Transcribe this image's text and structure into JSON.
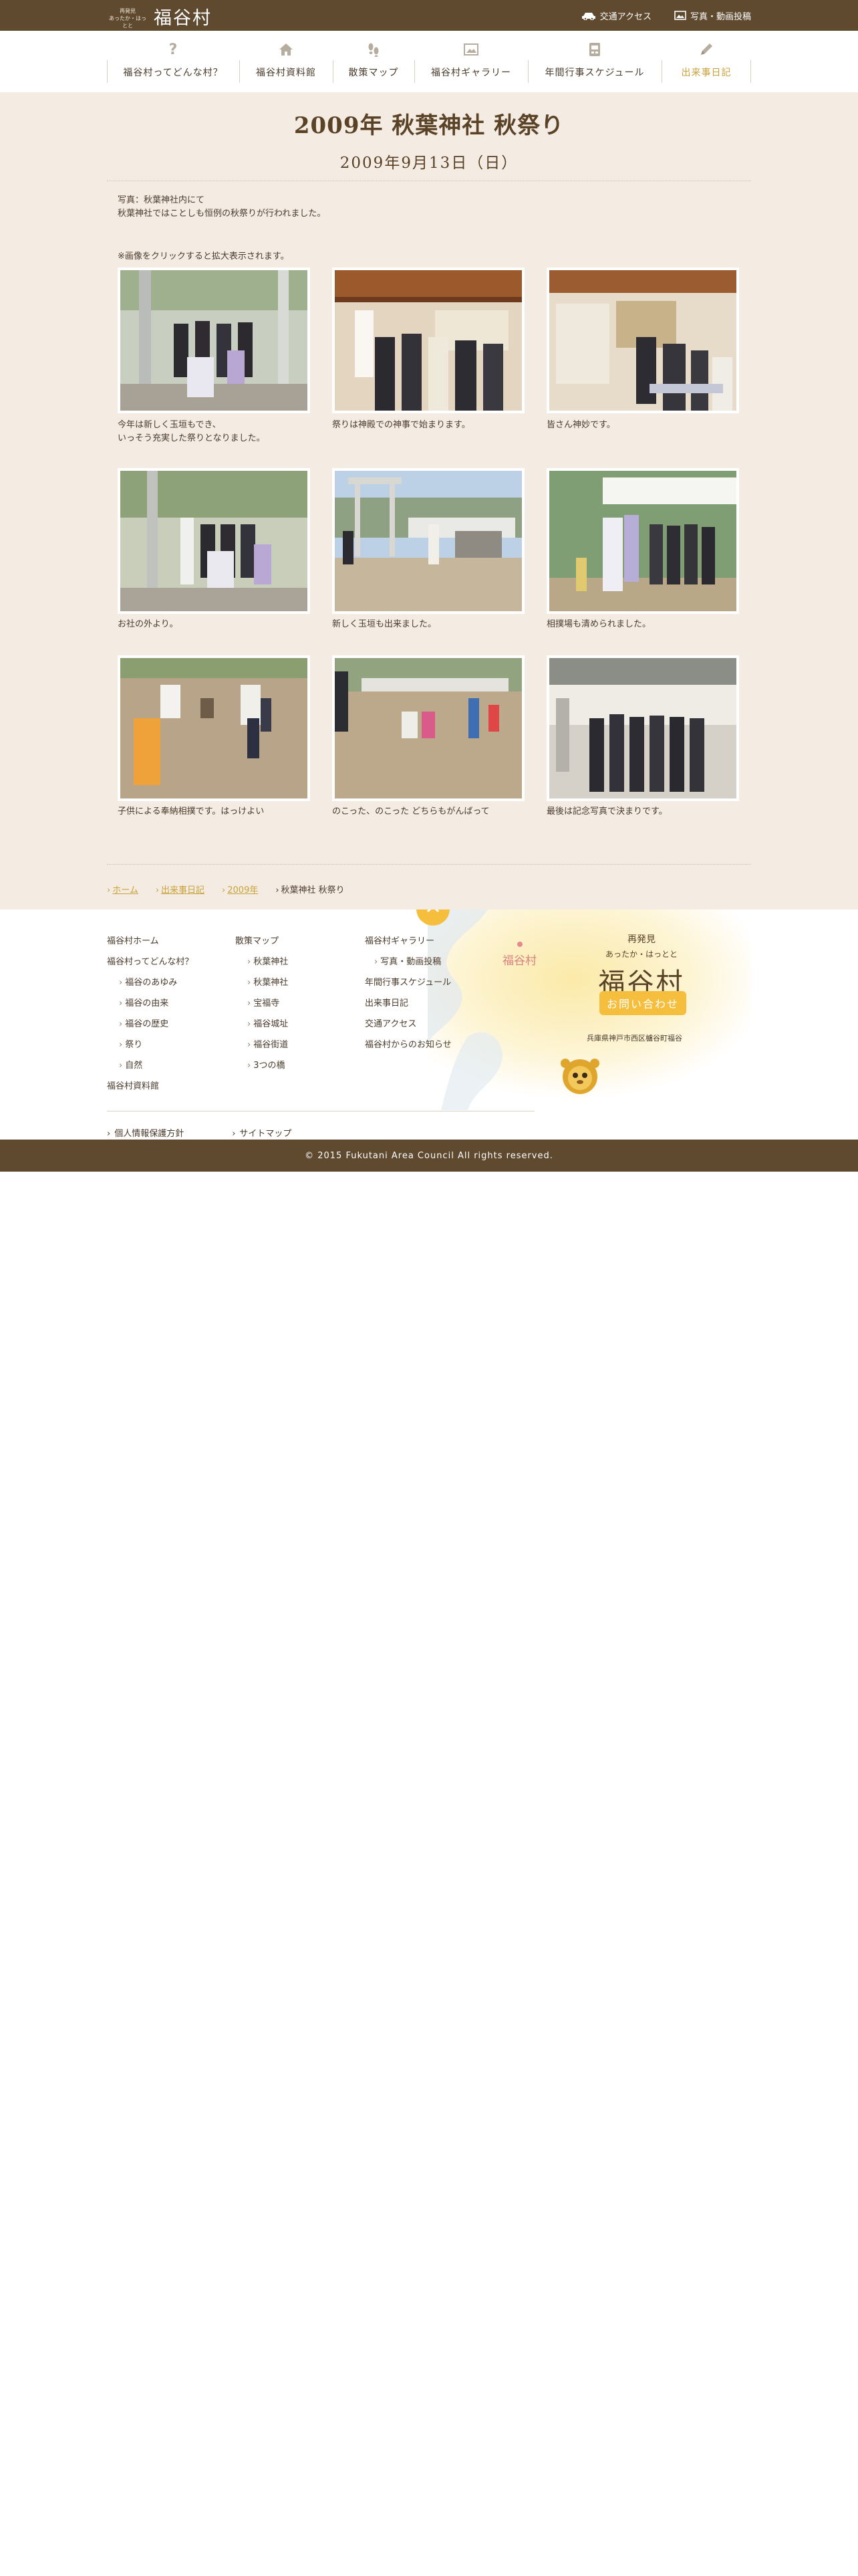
{
  "header": {
    "logo_tag_1": "再発見",
    "logo_tag_2": "あったか・はっとと",
    "site_name": "福谷村",
    "links": [
      "交通アクセス",
      "写真・動画投稿"
    ]
  },
  "nav": [
    {
      "label": "福谷村ってどんな村？",
      "icon": "question-icon"
    },
    {
      "label": "福谷村資料館",
      "icon": "house-icon"
    },
    {
      "label": "散策マップ",
      "icon": "footprints-icon"
    },
    {
      "label": "福谷村ギャラリー",
      "icon": "picture-icon"
    },
    {
      "label": "年間行事スケジュール",
      "icon": "calendar-icon"
    },
    {
      "label": "出来事日記",
      "icon": "pencil-icon",
      "active": true
    }
  ],
  "article": {
    "title": "2009年 秋葉神社 秋祭り",
    "date": "2009年9月13日（日）",
    "intro_1": "写真：秋葉神社内にて",
    "intro_2": "秋葉神社ではことしも恒例の秋祭りが行われました。",
    "note": "※画像をクリックすると拡大表示されます。",
    "photos": [
      {
        "caption_1": "今年は新しく玉垣もでき、",
        "caption_2": "いっそう充実した祭りとなりました。"
      },
      {
        "caption_1": "祭りは神殿での神事で始まります。",
        "caption_2": ""
      },
      {
        "caption_1": "皆さん神妙です。",
        "caption_2": ""
      },
      {
        "caption_1": "お社の外より。",
        "caption_2": ""
      },
      {
        "caption_1": "新しく玉垣も出来ました。",
        "caption_2": ""
      },
      {
        "caption_1": "相撲場も清められました。",
        "caption_2": ""
      },
      {
        "caption_1": "子供による奉納相撲です。はっけよい",
        "caption_2": ""
      },
      {
        "caption_1": "のこった、のこった どちらもがんばって",
        "caption_2": ""
      },
      {
        "caption_1": "最後は記念写真で決まりです。",
        "caption_2": ""
      }
    ]
  },
  "breadcrumb": [
    "ホーム",
    "出来事日記",
    "2009年",
    "秋葉神社 秋祭り"
  ],
  "footer": {
    "col1": [
      "福谷村ホーム",
      "福谷村ってどんな村？",
      "福谷のあゆみ",
      "福谷の由来",
      "福谷の歴史",
      "祭り",
      "自然",
      "福谷村資料館"
    ],
    "col2": [
      "散策マップ",
      "秋葉神社",
      "秋葉神社",
      "宝福寺",
      "福谷城址",
      "福谷街道",
      "3つの橋"
    ],
    "col3": [
      "福谷村ギャラリー",
      "写真・動画投稿",
      "年間行事スケジュール",
      "出来事日記",
      "交通アクセス",
      "福谷村からのお知らせ"
    ],
    "map_label": "福谷村",
    "brand_tag_1": "再発見",
    "brand_tag_2": "あったか・はっとと",
    "brand_name": "福谷村",
    "contact": "お問い合わせ",
    "address": "兵庫県神戸市西区櫨谷町福谷",
    "bottom_links": [
      "個人情報保護方針",
      "サイトマップ"
    ],
    "copyright": "© 2015 Fukutani Area Council All rights reserved."
  },
  "colors": {
    "header_bg": "#5f4a30",
    "main_bg": "#f4ebe3",
    "accent": "#c9a23b",
    "button": "#f5bf3d"
  }
}
